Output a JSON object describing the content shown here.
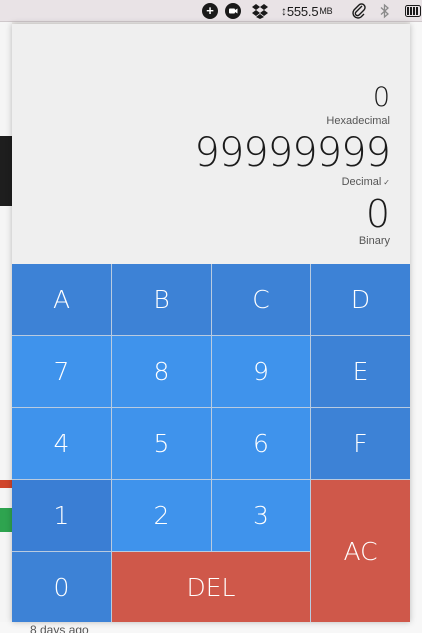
{
  "menubar": {
    "network_value": "555.5",
    "network_unit": "MB",
    "icons": [
      "add-circle-icon",
      "camera-icon",
      "dropbox-icon",
      "network-arrows-icon",
      "paperclip-icon",
      "bluetooth-icon",
      "battery-icon"
    ]
  },
  "display": {
    "hex_value": "0",
    "hex_label": "Hexadecimal",
    "dec_value": "99999999",
    "dec_label": "Decimal",
    "bin_value": "0",
    "bin_label": "Binary"
  },
  "keys": {
    "a": "A",
    "b": "B",
    "c": "C",
    "d": "D",
    "seven": "7",
    "eight": "8",
    "nine": "9",
    "e": "E",
    "four": "4",
    "five": "5",
    "six": "6",
    "f": "F",
    "one": "1",
    "two": "2",
    "three": "3",
    "ac": "AC",
    "zero": "0",
    "del": "DEL"
  },
  "background": {
    "footer_text": "8 days ago"
  },
  "colors": {
    "hex_key": "#3d82d6",
    "digit_key": "#3f93ec",
    "action_key": "#cf584a",
    "display_bg": "#efefef"
  }
}
